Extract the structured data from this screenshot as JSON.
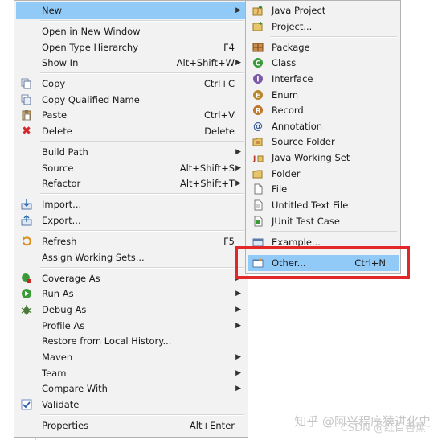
{
  "main_menu": {
    "items": [
      {
        "label": "New",
        "shortcut": "",
        "submenu": true,
        "icon": "none"
      },
      {
        "label": "Open in New Window",
        "shortcut": "",
        "submenu": false,
        "icon": "none"
      },
      {
        "label": "Open Type Hierarchy",
        "shortcut": "F4",
        "submenu": false,
        "icon": "none"
      },
      {
        "label": "Show In",
        "shortcut": "Alt+Shift+W",
        "submenu": true,
        "icon": "none"
      },
      {
        "label": "Copy",
        "shortcut": "Ctrl+C",
        "submenu": false,
        "icon": "copy-icon"
      },
      {
        "label": "Copy Qualified Name",
        "shortcut": "",
        "submenu": false,
        "icon": "copy-qualified-name-icon"
      },
      {
        "label": "Paste",
        "shortcut": "Ctrl+V",
        "submenu": false,
        "icon": "paste-icon"
      },
      {
        "label": "Delete",
        "shortcut": "Delete",
        "submenu": false,
        "icon": "delete-icon"
      },
      {
        "label": "Build Path",
        "shortcut": "",
        "submenu": true,
        "icon": "none"
      },
      {
        "label": "Source",
        "shortcut": "Alt+Shift+S",
        "submenu": true,
        "icon": "none"
      },
      {
        "label": "Refactor",
        "shortcut": "Alt+Shift+T",
        "submenu": true,
        "icon": "none"
      },
      {
        "label": "Import...",
        "shortcut": "",
        "submenu": false,
        "icon": "import-icon"
      },
      {
        "label": "Export...",
        "shortcut": "",
        "submenu": false,
        "icon": "export-icon"
      },
      {
        "label": "Refresh",
        "shortcut": "F5",
        "submenu": false,
        "icon": "refresh-icon"
      },
      {
        "label": "Assign Working Sets...",
        "shortcut": "",
        "submenu": false,
        "icon": "none"
      },
      {
        "label": "Coverage As",
        "shortcut": "",
        "submenu": true,
        "icon": "coverage-icon"
      },
      {
        "label": "Run As",
        "shortcut": "",
        "submenu": true,
        "icon": "run-icon"
      },
      {
        "label": "Debug As",
        "shortcut": "",
        "submenu": true,
        "icon": "debug-icon"
      },
      {
        "label": "Profile As",
        "shortcut": "",
        "submenu": true,
        "icon": "none"
      },
      {
        "label": "Restore from Local History...",
        "shortcut": "",
        "submenu": false,
        "icon": "none"
      },
      {
        "label": "Maven",
        "shortcut": "",
        "submenu": true,
        "icon": "none"
      },
      {
        "label": "Team",
        "shortcut": "",
        "submenu": true,
        "icon": "none"
      },
      {
        "label": "Compare With",
        "shortcut": "",
        "submenu": true,
        "icon": "none"
      },
      {
        "label": "Validate",
        "shortcut": "",
        "submenu": false,
        "icon": "validate-checkbox-icon"
      },
      {
        "label": "Properties",
        "shortcut": "Alt+Enter",
        "submenu": false,
        "icon": "none"
      }
    ]
  },
  "sub_menu": {
    "items": [
      {
        "label": "Java Project",
        "shortcut": "",
        "icon": "java-project-icon"
      },
      {
        "label": "Project...",
        "shortcut": "",
        "icon": "project-icon"
      },
      {
        "label": "Package",
        "shortcut": "",
        "icon": "package-icon"
      },
      {
        "label": "Class",
        "shortcut": "",
        "icon": "class-icon"
      },
      {
        "label": "Interface",
        "shortcut": "",
        "icon": "interface-icon"
      },
      {
        "label": "Enum",
        "shortcut": "",
        "icon": "enum-icon"
      },
      {
        "label": "Record",
        "shortcut": "",
        "icon": "record-icon"
      },
      {
        "label": "Annotation",
        "shortcut": "",
        "icon": "annotation-icon"
      },
      {
        "label": "Source Folder",
        "shortcut": "",
        "icon": "source-folder-icon"
      },
      {
        "label": "Java Working Set",
        "shortcut": "",
        "icon": "java-working-set-icon"
      },
      {
        "label": "Folder",
        "shortcut": "",
        "icon": "folder-icon"
      },
      {
        "label": "File",
        "shortcut": "",
        "icon": "file-icon"
      },
      {
        "label": "Untitled Text File",
        "shortcut": "",
        "icon": "untitled-text-file-icon"
      },
      {
        "label": "JUnit Test Case",
        "shortcut": "",
        "icon": "junit-test-case-icon"
      },
      {
        "label": "Example...",
        "shortcut": "",
        "icon": "example-icon"
      },
      {
        "label": "Other...",
        "shortcut": "Ctrl+N",
        "icon": "other-icon"
      }
    ]
  },
  "watermark": "知乎 @阿兴程序猿进化史",
  "watermark_overlay": "CSDN @红目香薰",
  "colors": {
    "highlight": "#91c9f7",
    "menu_bg": "#f2f2f2",
    "annotation_box": "#e32626"
  }
}
